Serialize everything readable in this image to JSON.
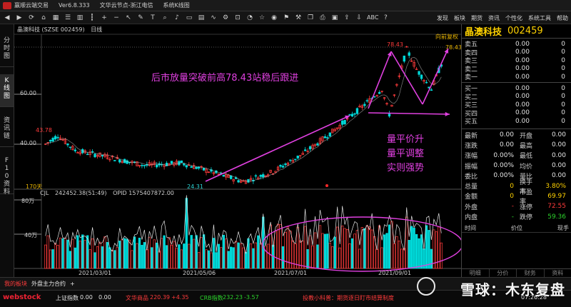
{
  "titlebar": {
    "app": "赢顺云端交易",
    "version": "Ver6.8.333",
    "node": "文华云节点-浙江电信",
    "mode": "系统K线图"
  },
  "toolbar": {
    "abc": "ABC",
    "right_menu": [
      "发现",
      "板块",
      "期货",
      "资讯",
      "个性化",
      "系统工具",
      "帮助"
    ]
  },
  "left_tabs": [
    "分时图",
    "K线图",
    "资讯链",
    "F10资料"
  ],
  "chart": {
    "header_name": "晶澳科技",
    "header_code": "(SZSE 002459)",
    "period": "日线",
    "adjust_label": "向前复权",
    "price_ticks": [
      "60.00",
      "40.00"
    ],
    "volume_ticks": [
      "80万",
      "40万"
    ],
    "hi_label": "78.43",
    "left_hi": "43.78",
    "low_label": "24.31",
    "right_tag": "78.43",
    "days_label": "170天",
    "volume_header": "CJL",
    "volume_value": "242452.38(51:49)",
    "opid": "OPID 1575407872.00",
    "dates": [
      "2021/03/01",
      "2021/05/06",
      "2021/07/01",
      "2021/09/01"
    ],
    "annotation_main": "后市放量突破前高78.43站稳后跟进",
    "annotation_side": [
      "量平价升",
      "量平调整",
      "实则强势"
    ],
    "colors": {
      "up": "#ff3b3b",
      "down": "#00d8d8",
      "annotation": "#e040e0",
      "ma": "#ffffff"
    }
  },
  "panel": {
    "name": "晶澳科技",
    "code": "002459",
    "asks": [
      {
        "k": "卖五",
        "p": "0.00",
        "v": "0"
      },
      {
        "k": "卖四",
        "p": "0.00",
        "v": "0"
      },
      {
        "k": "卖三",
        "p": "0.00",
        "v": "0"
      },
      {
        "k": "卖二",
        "p": "0.00",
        "v": "0"
      },
      {
        "k": "卖一",
        "p": "0.00",
        "v": "0"
      }
    ],
    "bids": [
      {
        "k": "买一",
        "p": "0.00",
        "v": "0"
      },
      {
        "k": "买二",
        "p": "0.00",
        "v": "0"
      },
      {
        "k": "买三",
        "p": "0.00",
        "v": "0"
      },
      {
        "k": "买四",
        "p": "0.00",
        "v": "0"
      },
      {
        "k": "买五",
        "p": "0.00",
        "v": "0"
      }
    ],
    "stats": [
      {
        "k1": "最新",
        "v1": "0.00",
        "k2": "开盘",
        "v2": "0.00",
        "c1": "white",
        "c2": "white"
      },
      {
        "k1": "涨跌",
        "v1": "0.00",
        "k2": "最高",
        "v2": "0.00",
        "c1": "white",
        "c2": "white"
      },
      {
        "k1": "涨幅",
        "v1": "0.00%",
        "k2": "最低",
        "v2": "0.00",
        "c1": "white",
        "c2": "white"
      },
      {
        "k1": "振幅",
        "v1": "0.00%",
        "k2": "均价",
        "v2": "0.00",
        "c1": "white",
        "c2": "white"
      },
      {
        "k1": "委比",
        "v1": "0.00%",
        "k2": "量比",
        "v2": "0.00",
        "c1": "white",
        "c2": "white"
      },
      {
        "k1": "总量",
        "v1": "0",
        "k2": "换手率",
        "v2": "3.80%",
        "c1": "yellow",
        "c2": "yellow"
      },
      {
        "k1": "金额",
        "v1": "0",
        "k2": "市盈率",
        "v2": "69.97",
        "c1": "yellow",
        "c2": "yellow"
      },
      {
        "k1": "外盘",
        "v1": "-",
        "k2": "涨停",
        "v2": "72.55",
        "c1": "red",
        "c2": "red"
      },
      {
        "k1": "内盘",
        "v1": "-",
        "k2": "跌停",
        "v2": "59.36",
        "c1": "green",
        "c2": "green"
      }
    ],
    "trade_headers": [
      "时间",
      "价位",
      "现手"
    ],
    "bottom_tabs": [
      "明细",
      "分价",
      "财务",
      "资料"
    ]
  },
  "bottom_tabs": [
    "我的板块",
    "外盘主力合约",
    "+"
  ],
  "status": {
    "brand": "webstock",
    "idx1_name": "上证指数",
    "idx1_val": "0.00",
    "idx1_chg": "0.00",
    "idx2_name": "文华商品",
    "idx2_val": "220.39",
    "idx2_chg": "+4.35",
    "idx3_name": "CRB指数",
    "idx3_val": "232.23",
    "idx3_chg": "-3.57",
    "notice": "投教小科普：期货逐日盯市结算制度",
    "time": "07:26:28",
    "watermark": "雪球：木东复盘"
  }
}
